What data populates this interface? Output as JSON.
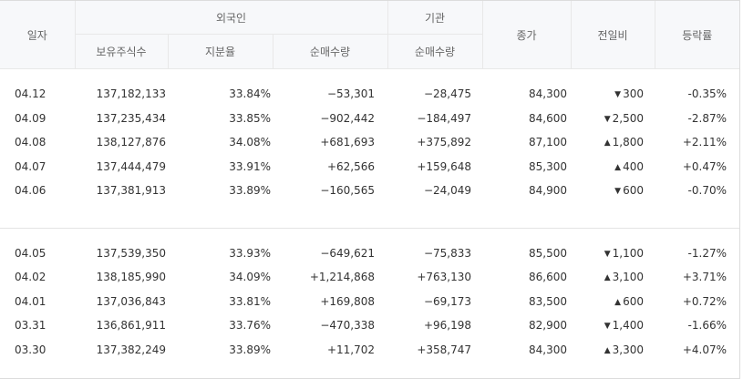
{
  "headers": {
    "date": "일자",
    "foreign_group": "외국인",
    "institution_group": "기관",
    "close": "종가",
    "change": "전일비",
    "rate": "등락률",
    "foreign_holdings": "보유주식수",
    "foreign_ratio": "지분율",
    "foreign_net": "순매수량",
    "institution_net": "순매수량"
  },
  "rows_group1": [
    {
      "date": "04.12",
      "holdings": "137,182,133",
      "ratio": "33.84%",
      "foreign_net": "−53,301",
      "foreign_dir": "down",
      "inst_net": "−28,475",
      "inst_dir": "down",
      "close": "84,300",
      "close_dir": "down",
      "arrow": "▼",
      "change": "300",
      "change_dir": "down",
      "rate": "-0.35%",
      "rate_dir": "down"
    },
    {
      "date": "04.09",
      "holdings": "137,235,434",
      "ratio": "33.85%",
      "foreign_net": "−902,442",
      "foreign_dir": "down",
      "inst_net": "−184,497",
      "inst_dir": "down",
      "close": "84,600",
      "close_dir": "down",
      "arrow": "▼",
      "change": "2,500",
      "change_dir": "down",
      "rate": "-2.87%",
      "rate_dir": "down"
    },
    {
      "date": "04.08",
      "holdings": "138,127,876",
      "ratio": "34.08%",
      "foreign_net": "+681,693",
      "foreign_dir": "up",
      "inst_net": "+375,892",
      "inst_dir": "up",
      "close": "87,100",
      "close_dir": "up",
      "arrow": "▲",
      "change": "1,800",
      "change_dir": "up",
      "rate": "+2.11%",
      "rate_dir": "up"
    },
    {
      "date": "04.07",
      "holdings": "137,444,479",
      "ratio": "33.91%",
      "foreign_net": "+62,566",
      "foreign_dir": "up",
      "inst_net": "+159,648",
      "inst_dir": "up",
      "close": "85,300",
      "close_dir": "up",
      "arrow": "▲",
      "change": "400",
      "change_dir": "up",
      "rate": "+0.47%",
      "rate_dir": "up"
    },
    {
      "date": "04.06",
      "holdings": "137,381,913",
      "ratio": "33.89%",
      "foreign_net": "−160,565",
      "foreign_dir": "down",
      "inst_net": "−24,049",
      "inst_dir": "down",
      "close": "84,900",
      "close_dir": "down",
      "arrow": "▼",
      "change": "600",
      "change_dir": "down",
      "rate": "-0.70%",
      "rate_dir": "down"
    }
  ],
  "rows_group2": [
    {
      "date": "04.05",
      "holdings": "137,539,350",
      "ratio": "33.93%",
      "foreign_net": "−649,621",
      "foreign_dir": "down",
      "inst_net": "−75,833",
      "inst_dir": "down",
      "close": "85,500",
      "close_dir": "down",
      "arrow": "▼",
      "change": "1,100",
      "change_dir": "down",
      "rate": "-1.27%",
      "rate_dir": "down"
    },
    {
      "date": "04.02",
      "holdings": "138,185,990",
      "ratio": "34.09%",
      "foreign_net": "+1,214,868",
      "foreign_dir": "up",
      "inst_net": "+763,130",
      "inst_dir": "up",
      "close": "86,600",
      "close_dir": "up",
      "arrow": "▲",
      "change": "3,100",
      "change_dir": "up",
      "rate": "+3.71%",
      "rate_dir": "up"
    },
    {
      "date": "04.01",
      "holdings": "137,036,843",
      "ratio": "33.81%",
      "foreign_net": "+169,808",
      "foreign_dir": "up",
      "inst_net": "−69,173",
      "inst_dir": "down",
      "close": "83,500",
      "close_dir": "up",
      "arrow": "▲",
      "change": "600",
      "change_dir": "up",
      "rate": "+0.72%",
      "rate_dir": "up"
    },
    {
      "date": "03.31",
      "holdings": "136,861,911",
      "ratio": "33.76%",
      "foreign_net": "−470,338",
      "foreign_dir": "down",
      "inst_net": "+96,198",
      "inst_dir": "up",
      "close": "82,900",
      "close_dir": "down",
      "arrow": "▼",
      "change": "1,400",
      "change_dir": "down",
      "rate": "-1.66%",
      "rate_dir": "down"
    },
    {
      "date": "03.30",
      "holdings": "137,382,249",
      "ratio": "33.89%",
      "foreign_net": "+11,702",
      "foreign_dir": "up",
      "inst_net": "+358,747",
      "inst_dir": "up",
      "close": "84,300",
      "close_dir": "up",
      "arrow": "▲",
      "change": "3,300",
      "change_dir": "up",
      "rate": "+4.07%",
      "rate_dir": "up"
    }
  ],
  "colors": {
    "up": "#e2213a",
    "down": "#2c5fc7",
    "header_bg": "#f7f8fa"
  },
  "icons": {
    "up": "up-triangle-icon",
    "down": "down-triangle-icon"
  }
}
